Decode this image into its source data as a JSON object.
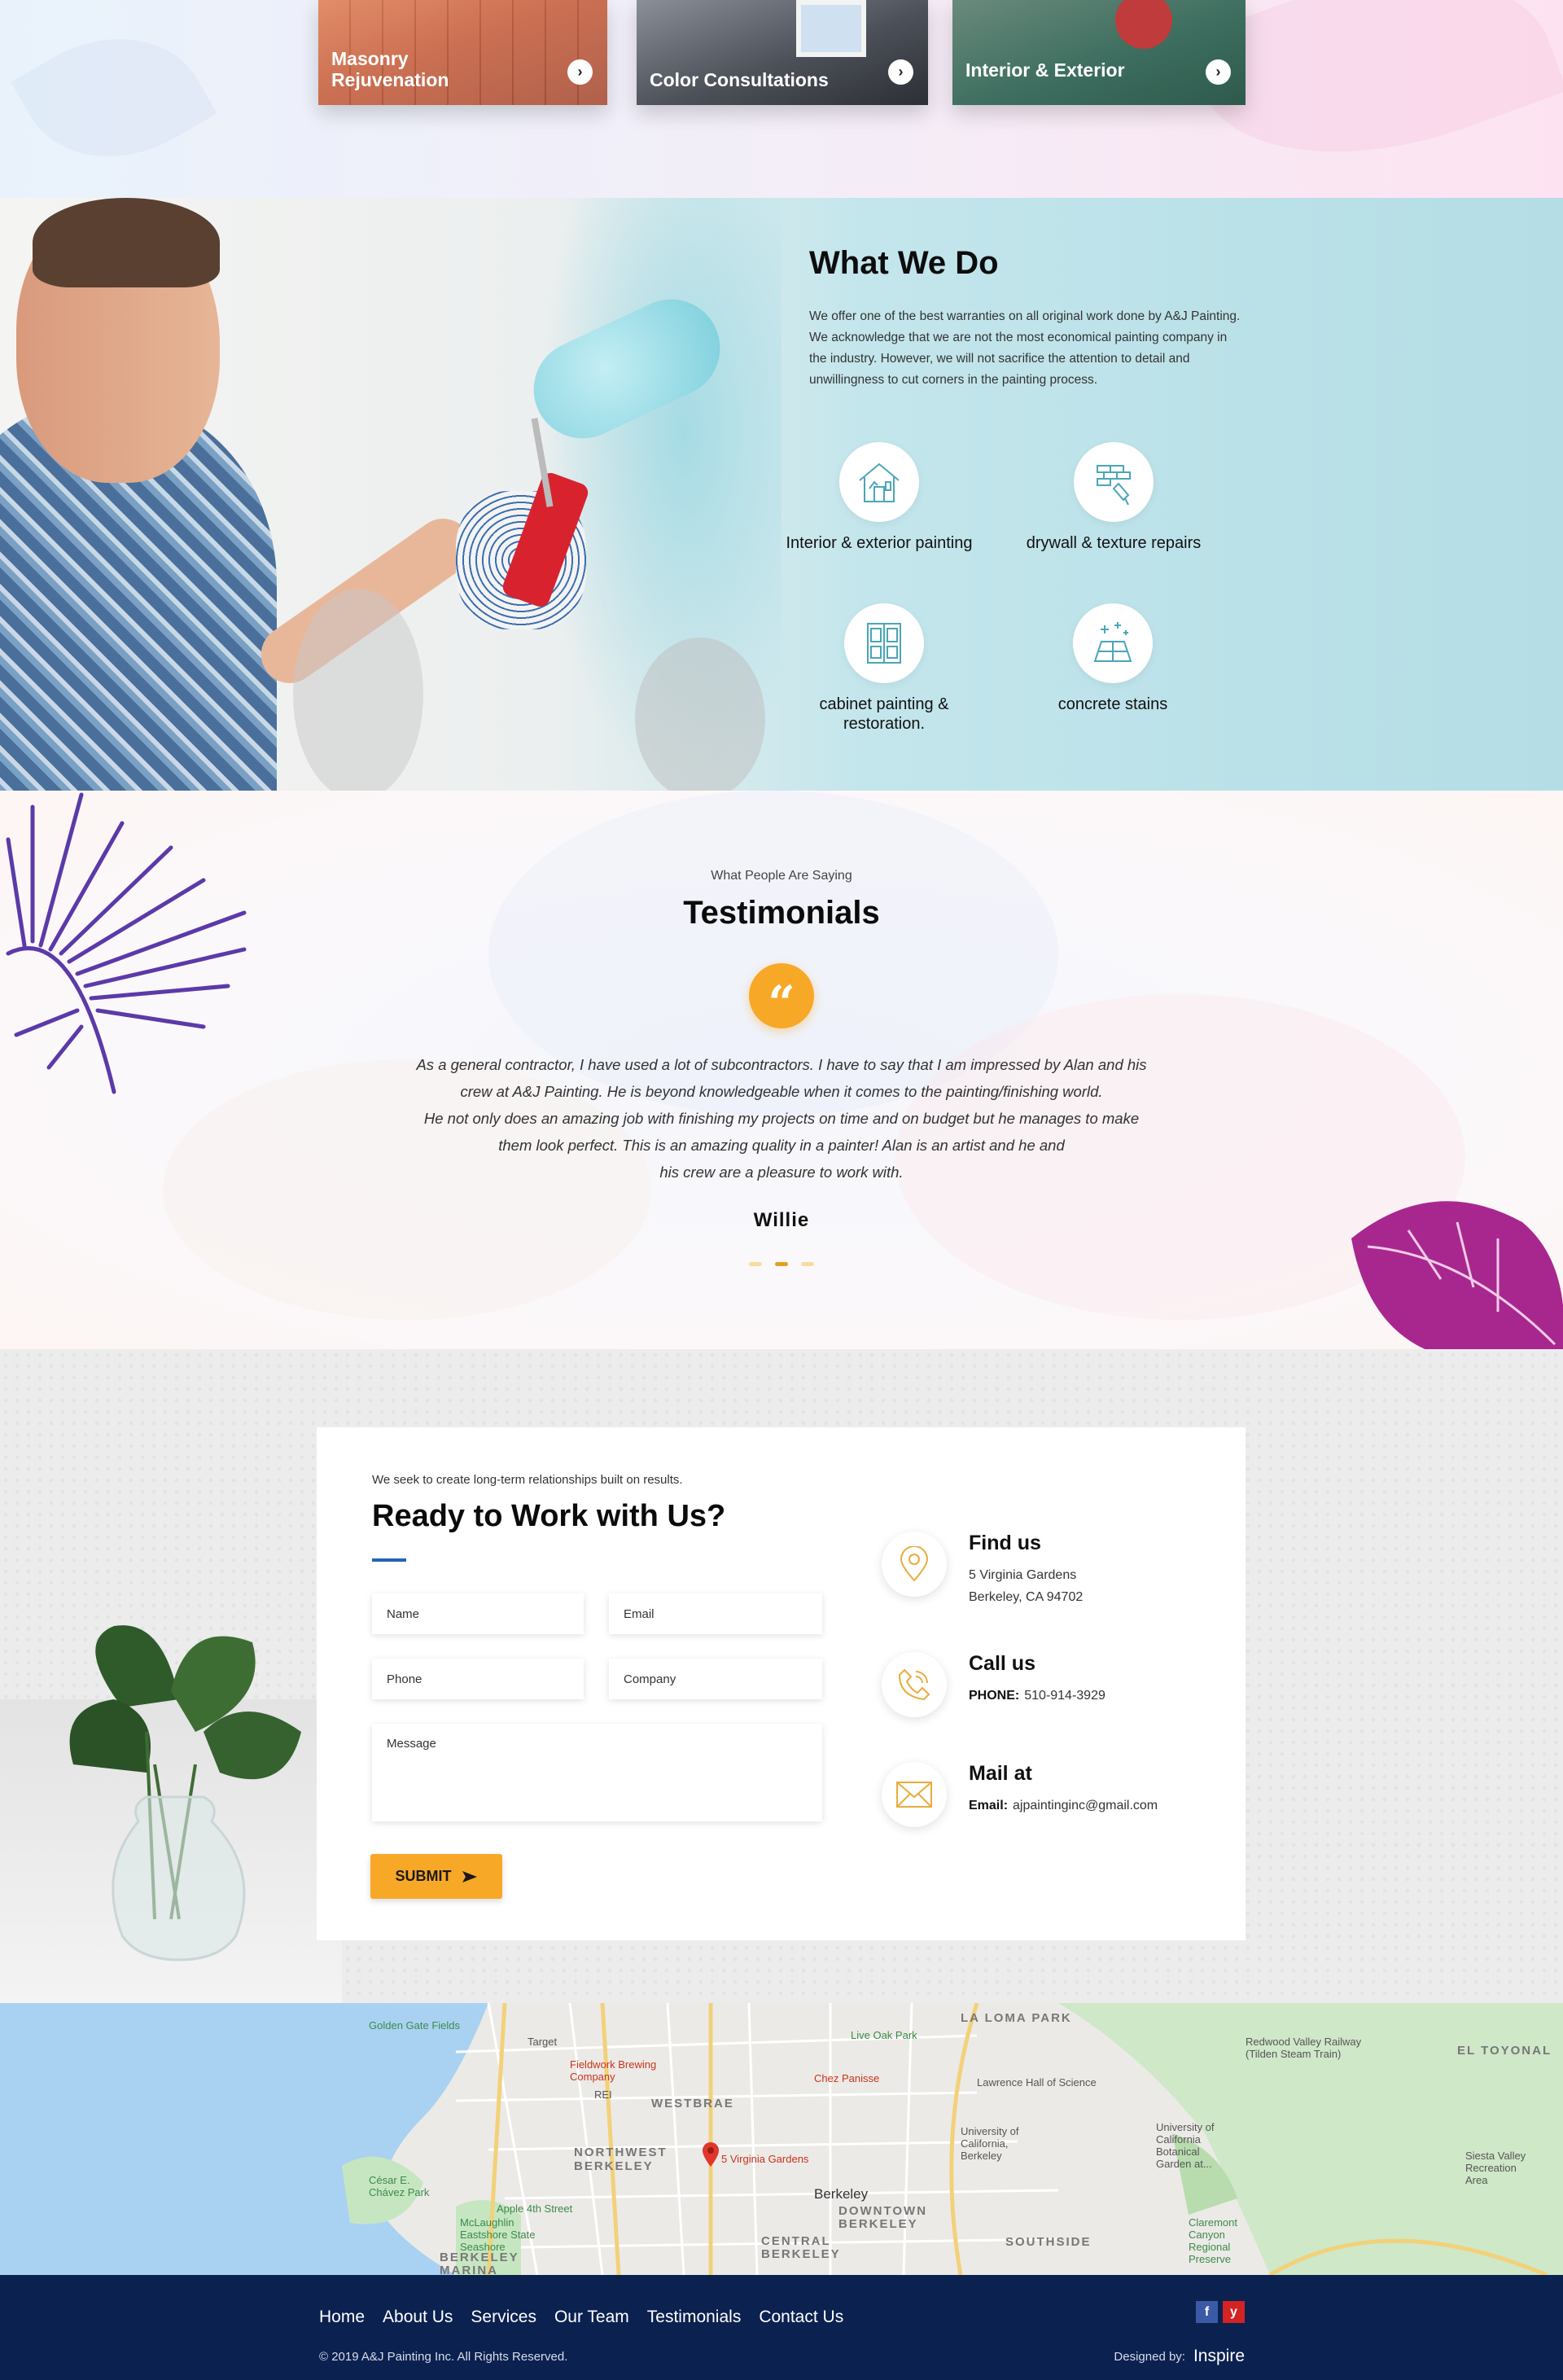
{
  "services": {
    "cards": [
      {
        "label": "Masonry Rejuvenation",
        "arrow": "›"
      },
      {
        "label": "Color Consultations",
        "arrow": "›"
      },
      {
        "label": "Interior & Exterior",
        "arrow": "›"
      }
    ]
  },
  "what_we_do": {
    "title": "What We Do",
    "text": "We offer one of the best warranties on all original work done by A&J Painting. We acknowledge that we are not the most economical painting company in the industry. However, we will not sacrifice the attention to detail and unwillingness to cut corners in the painting process.",
    "features": [
      {
        "label": "Interior & exterior painting",
        "icon": "house-painting-icon"
      },
      {
        "label": "drywall & texture repairs",
        "icon": "bricks-trowel-icon"
      },
      {
        "label": "cabinet painting & restoration.",
        "icon": "cabinet-icon"
      },
      {
        "label": "concrete stains",
        "icon": "floor-tiles-icon"
      }
    ]
  },
  "testimonials": {
    "kicker": "What People Are Saying",
    "title": "Testimonials",
    "quote_mark": "“",
    "lines": [
      "As a general contractor, I have used a lot of subcontractors.  I have to say that I am impressed by Alan and his",
      "crew at A&J Painting.  He is beyond knowledgeable when it comes to the painting/finishing world.",
      "He not only does an amazing job with finishing my projects on time and on budget but he manages to make",
      "them look perfect.  This is an amazing quality in a painter!  Alan is an artist and he and",
      "his crew are a pleasure to work with."
    ],
    "author": "Willie",
    "active_slide": 2,
    "slide_count": 3
  },
  "contact": {
    "kicker": "We seek to create long-term relationships built on results.",
    "title": "Ready to Work with Us?",
    "fields": {
      "name": "Name",
      "email": "Email",
      "phone": "Phone",
      "company": "Company",
      "message": "Message"
    },
    "submit": "SUBMIT",
    "find": {
      "title": "Find us",
      "line1": "5 Virginia Gardens",
      "line2": "Berkeley, CA 94702"
    },
    "call": {
      "title": "Call us",
      "label": "PHONE:",
      "value": "510-914-3929"
    },
    "mail": {
      "title": "Mail at",
      "label": "Email:",
      "value": "ajpaintinginc@gmail.com"
    }
  },
  "map": {
    "pin_label": "5 Virginia Gardens",
    "labels": {
      "golden_gate_fields": "Golden Gate Fields",
      "target": "Target",
      "fieldwork": "Fieldwork Brewing Company",
      "rei": "REI",
      "westbrae": "WESTBRAE",
      "northwest_berkeley": "NORTHWEST BERKELEY",
      "live_oak_park": "Live Oak Park",
      "la_loma_park": "LA LOMA PARK",
      "chez_panisse": "Chez Panisse",
      "lawrence_hall": "Lawrence Hall of Science",
      "redwood_valley": "Redwood Valley Railway (Tilden Steam Train)",
      "el_toyonal": "EL TOYONAL",
      "uc_berkeley": "University of California, Berkeley",
      "botanical": "University of California Botanical Garden at...",
      "berkeley": "Berkeley",
      "downtown": "DOWNTOWN BERKELEY",
      "cesar_chavez": "César E. Chávez Park",
      "apple": "Apple 4th Street",
      "mclaughlin": "McLaughlin Eastshore State Seashore",
      "berkeley_marina": "BERKELEY MARINA",
      "central_berkeley": "CENTRAL BERKELEY",
      "southside": "SOUTHSIDE",
      "claremont": "Claremont Canyon Regional Preserve",
      "siesta_valley": "Siesta Valley Recreation Area"
    }
  },
  "footer": {
    "nav": [
      "Home",
      "About Us",
      "Services",
      "Our Team",
      "Testimonials",
      "Contact Us"
    ],
    "copyright": "© 2019 A&J Painting Inc. All Rights Reserved.",
    "designed_by": "Designed by:",
    "designer": "Inspire",
    "social": {
      "facebook": "f",
      "yelp": "y"
    }
  },
  "colors": {
    "accent": "#f8a827",
    "footer_bg": "#0b2150",
    "title_bar": "#2563b8",
    "teal_icon": "#4aa6b8"
  }
}
